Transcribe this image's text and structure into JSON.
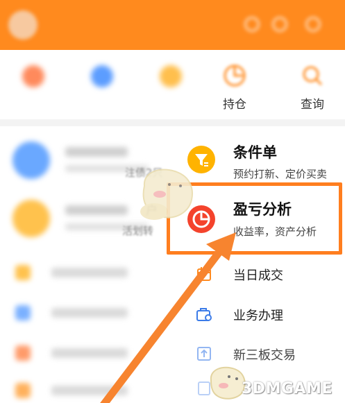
{
  "header": {
    "title": ""
  },
  "quick_entries": [
    {
      "label": "",
      "icon": "buy-icon",
      "color": "#ff8a5c"
    },
    {
      "label": "",
      "icon": "sell-icon",
      "color": "#5c9dff"
    },
    {
      "label": "",
      "icon": "cancel-icon",
      "color": "#ffbf4d"
    },
    {
      "label": "持仓",
      "icon": "holdings-icon",
      "color": "#ff8a1e"
    },
    {
      "label": "查询",
      "icon": "query-icon",
      "color": "#ff8a1e"
    }
  ],
  "background_fragments": {
    "frag1": "注债2只",
    "frag2": "户",
    "frag3": "活划转"
  },
  "menu": {
    "conditional_order": {
      "title": "条件单",
      "subtitle": "预约打新、定价买卖",
      "icon": "funnel-icon",
      "color": "#ffb300"
    },
    "pnl_analysis": {
      "title": "盈亏分析",
      "subtitle": "收益率，资产分析",
      "icon": "pie-chart-icon",
      "color": "#f4432c"
    },
    "daily_trades": {
      "label": "当日成交",
      "icon": "calendar-icon"
    },
    "business": {
      "label": "业务办理",
      "icon": "briefcase-icon"
    },
    "neeq_trading": {
      "label": "新三板交易",
      "icon": "upload-icon"
    }
  },
  "watermark": {
    "text": "3DMGAME"
  },
  "colors": {
    "accent": "#ff8a1e",
    "highlight": "#ff7e1f",
    "arrow": "#f7842f"
  }
}
